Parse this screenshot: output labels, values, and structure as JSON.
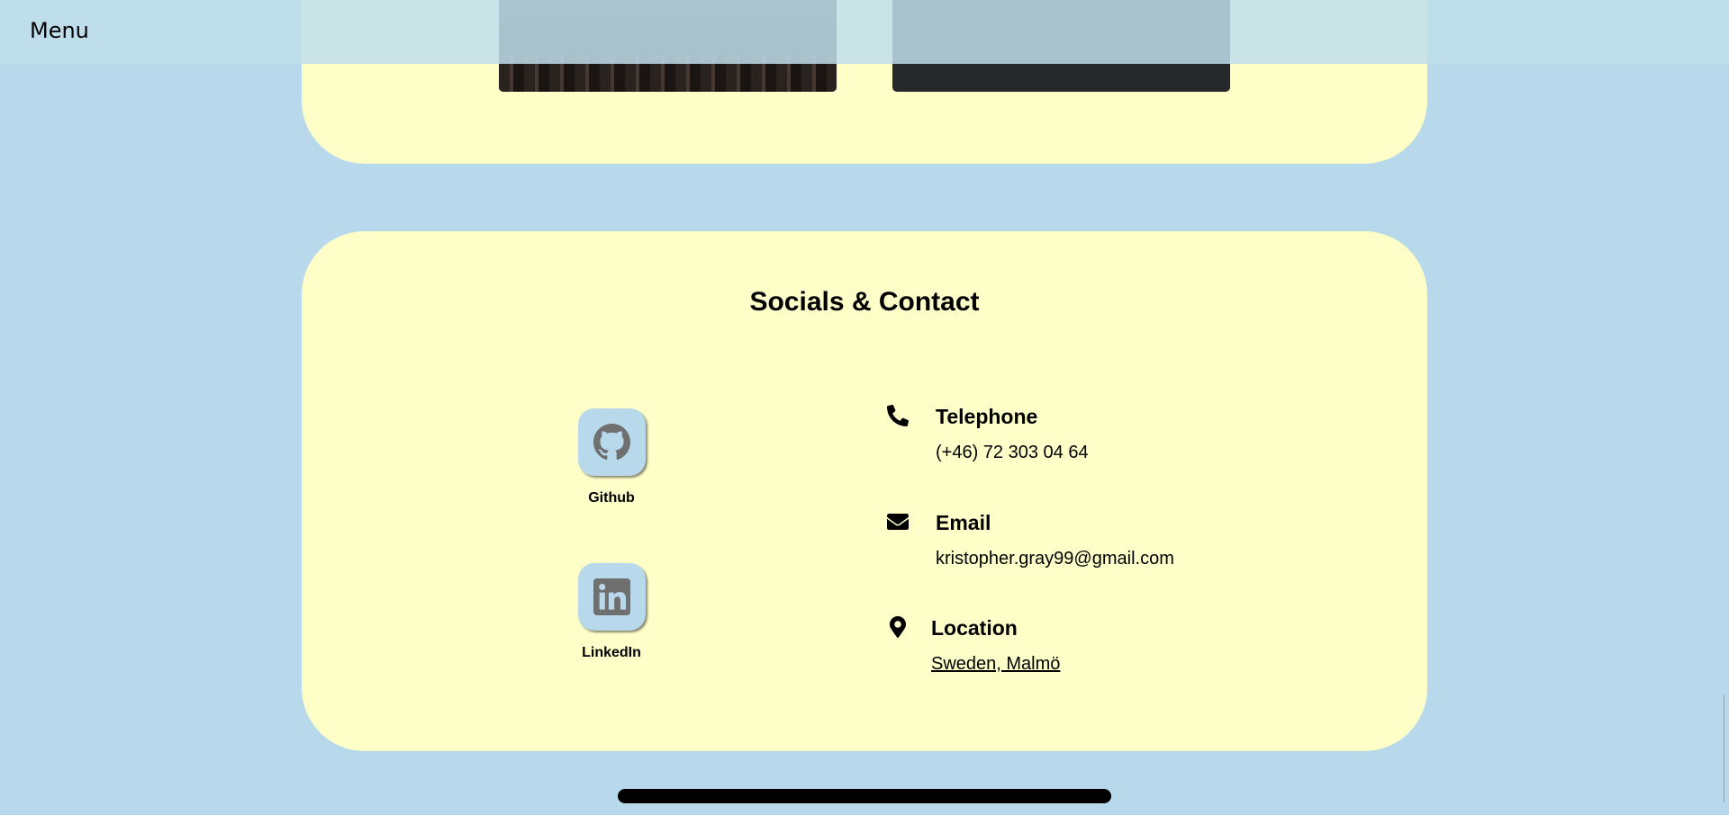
{
  "header": {
    "menu_label": "Menu"
  },
  "contact_section": {
    "title": "Socials & Contact",
    "socials": [
      {
        "label": "Github",
        "icon": "github-icon"
      },
      {
        "label": "LinkedIn",
        "icon": "linkedin-icon"
      }
    ],
    "contacts": [
      {
        "title": "Telephone",
        "value": "(+46) 72 303 04 64",
        "icon": "phone-icon"
      },
      {
        "title": "Email",
        "value": "kristopher.gray99@gmail.com",
        "icon": "envelope-icon"
      },
      {
        "title": "Location",
        "value": "Sweden, Malmö",
        "icon": "map-pin-icon"
      }
    ]
  },
  "colors": {
    "page_background": "#b8d9ec",
    "card_background": "#fdfec8",
    "social_button_background": "#b8d9ec",
    "social_icon_color": "#6f6f6f",
    "text": "#000000"
  }
}
